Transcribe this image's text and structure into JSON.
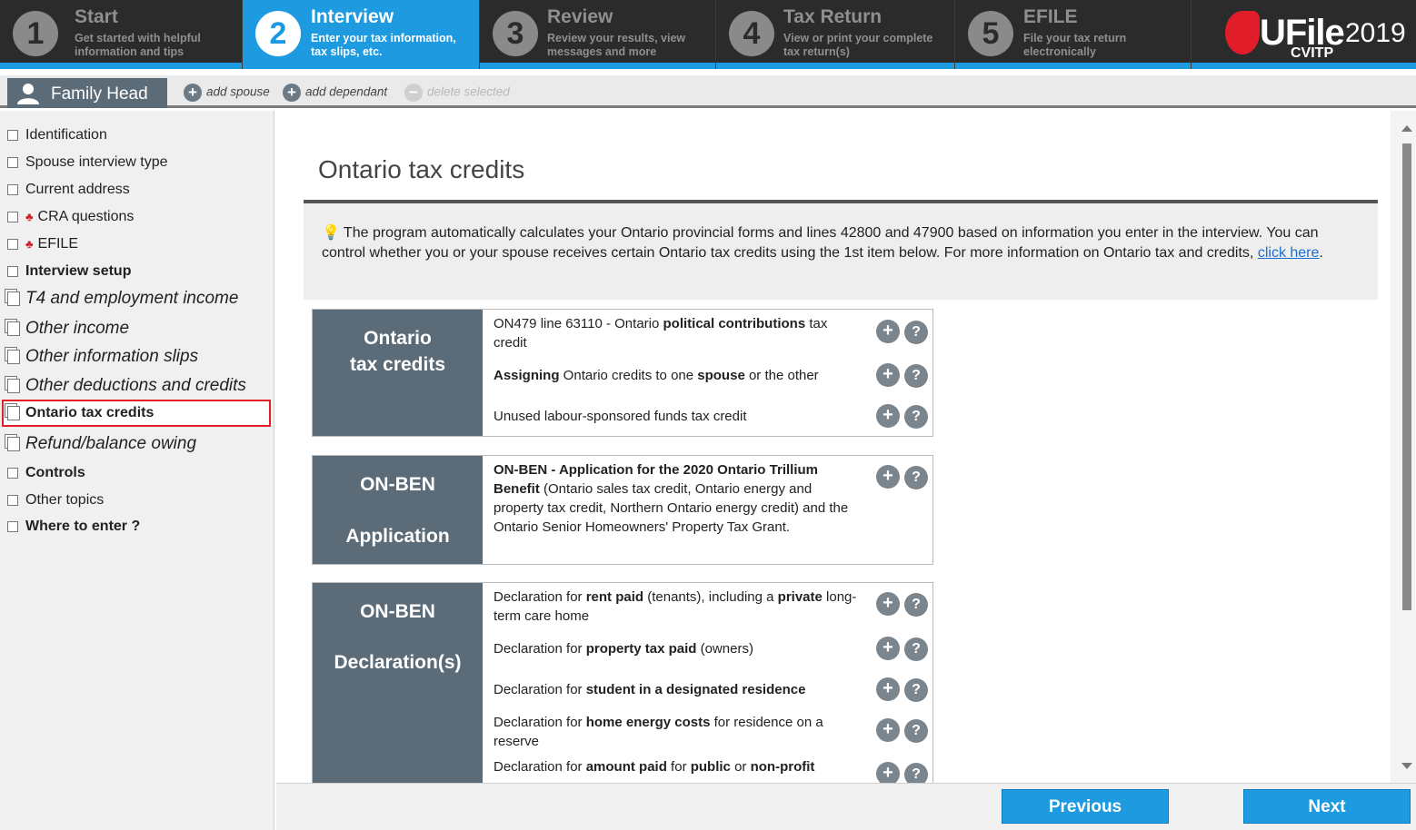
{
  "steps": [
    {
      "num": "1",
      "title": "Start",
      "sub1": "Get started with helpful",
      "sub2": "information and tips"
    },
    {
      "num": "2",
      "title": "Interview",
      "sub1": "Enter your tax information,",
      "sub2": "tax slips, etc."
    },
    {
      "num": "3",
      "title": "Review",
      "sub1": "Review your results, view",
      "sub2": "messages and more"
    },
    {
      "num": "4",
      "title": "Tax Return",
      "sub1": "View or print your complete",
      "sub2": "tax return(s)"
    },
    {
      "num": "5",
      "title": "EFILE",
      "sub1": "File your tax return",
      "sub2": "electronically"
    }
  ],
  "logo": {
    "brand": "UFile",
    "year": "2019",
    "edition": "CVITP"
  },
  "subbar": {
    "family_tab": "Family Head",
    "add_spouse": "add spouse",
    "add_dependant": "add dependant",
    "delete_selected": "delete selected"
  },
  "sidebar": [
    "Identification",
    "Spouse interview type",
    "Current address",
    "CRA questions",
    "EFILE",
    "Interview setup",
    "T4 and employment income",
    "Other income",
    "Other information slips",
    "Other deductions and credits",
    "Ontario tax credits",
    "Refund/balance owing",
    "Controls",
    "Other topics",
    "Where to enter ?"
  ],
  "main": {
    "title": "Ontario tax credits",
    "info_text": "The program automatically calculates your Ontario provincial forms and lines 42800 and 47900 based on information you enter in the interview. You can control whether you or your spouse receives certain Ontario tax credits using the 1st item below. For more information on Ontario tax and credits, ",
    "info_link": "click here",
    "info_end": "."
  },
  "groups": {
    "g1": {
      "line1": "Ontario",
      "line2": "tax credits"
    },
    "g2": {
      "line1": "ON-BEN",
      "line2": "Application"
    },
    "g3": {
      "line1": "ON-BEN",
      "line2": "Declaration(s)"
    }
  },
  "rows": {
    "r1": {
      "a": "ON479 line 63110 - Ontario ",
      "b": "political contributions",
      "c": " tax credit"
    },
    "r2": {
      "a": "Assigning",
      "b": " Ontario credits to one ",
      "c": "spouse",
      "d": " or the other"
    },
    "r3": {
      "a": "Unused labour-sponsored funds tax credit"
    },
    "r4": {
      "a": "ON-BEN - Application for the 2020 Ontario Trillium Benefit",
      "b": " (Ontario sales tax credit, Ontario energy and property tax credit, Northern Ontario energy credit) and the Ontario Senior Homeowners' Property Tax Grant."
    },
    "r5": {
      "a": "Declaration for ",
      "b": "rent paid",
      "c": " (tenants), including a ",
      "d": "private",
      "e": " long-term care home"
    },
    "r6": {
      "a": "Declaration for ",
      "b": "property tax paid",
      "c": " (owners)"
    },
    "r7": {
      "a": "Declaration for ",
      "b": "student in a designated residence"
    },
    "r8": {
      "a": "Declaration for ",
      "b": "home energy costs",
      "c": " for residence on a reserve"
    },
    "r9": {
      "a": "Declaration for ",
      "b": "amount paid",
      "c": " for ",
      "d": "public",
      "e": " or ",
      "f": "non-profit"
    }
  },
  "buttons": {
    "add": "+",
    "help": "?"
  },
  "footer": {
    "previous": "Previous",
    "next": "Next"
  },
  "colors": {
    "accent": "#1e9ae0",
    "topbar": "#2b2b2b",
    "group_label": "#5b6b78",
    "highlight": "#e31e24"
  }
}
